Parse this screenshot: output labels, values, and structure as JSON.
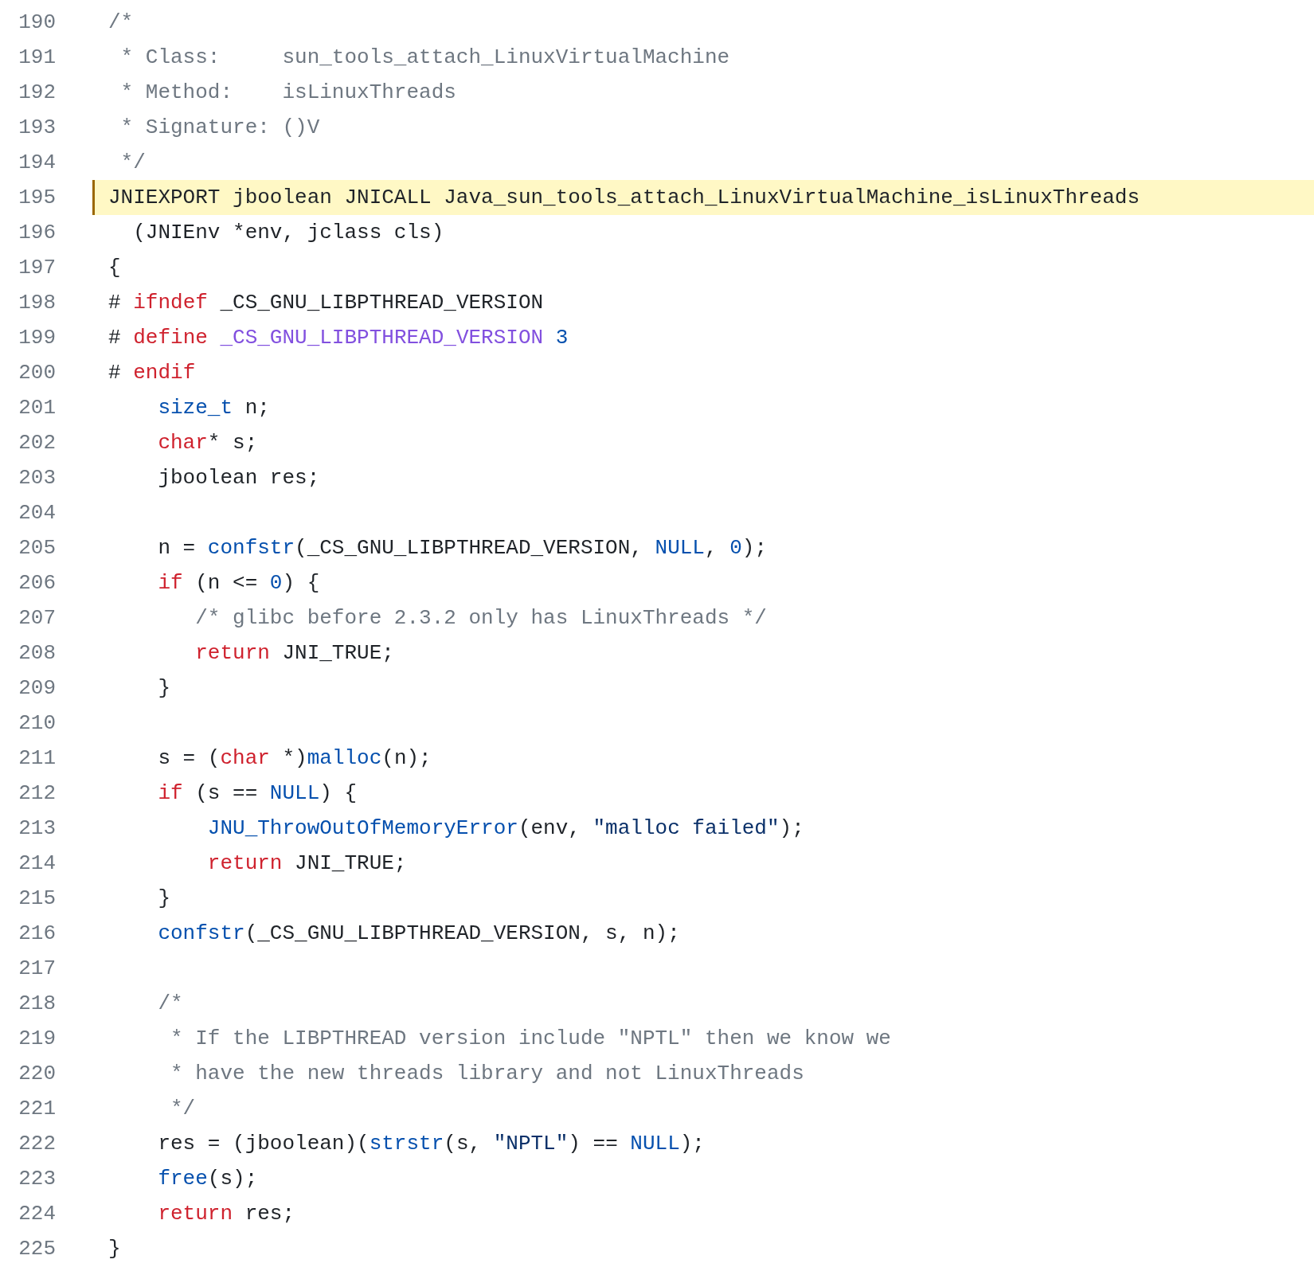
{
  "lines": [
    {
      "number": "190",
      "highlighted": false,
      "tokens": [
        {
          "text": "/*",
          "kind": "comment"
        }
      ]
    },
    {
      "number": "191",
      "highlighted": false,
      "tokens": [
        {
          "text": " * Class:     sun_tools_attach_LinuxVirtualMachine",
          "kind": "comment"
        }
      ]
    },
    {
      "number": "192",
      "highlighted": false,
      "tokens": [
        {
          "text": " * Method:    isLinuxThreads",
          "kind": "comment"
        }
      ]
    },
    {
      "number": "193",
      "highlighted": false,
      "tokens": [
        {
          "text": " * Signature: ()V",
          "kind": "comment"
        }
      ]
    },
    {
      "number": "194",
      "highlighted": false,
      "tokens": [
        {
          "text": " */",
          "kind": "comment"
        }
      ]
    },
    {
      "number": "195",
      "highlighted": true,
      "tokens": [
        {
          "text": "JNIEXPORT jboolean JNICALL Java_sun_tools_attach_LinuxVirtualMachine_isLinuxThreads",
          "kind": "plain"
        }
      ]
    },
    {
      "number": "196",
      "highlighted": false,
      "tokens": [
        {
          "text": "  (JNIEnv *env, jclass cls)",
          "kind": "plain"
        }
      ]
    },
    {
      "number": "197",
      "highlighted": false,
      "tokens": [
        {
          "text": "{",
          "kind": "plain"
        }
      ]
    },
    {
      "number": "198",
      "highlighted": false,
      "tokens": [
        {
          "text": "# ",
          "kind": "plain"
        },
        {
          "text": "ifndef",
          "kind": "keyword"
        },
        {
          "text": " _CS_GNU_LIBPTHREAD_VERSION",
          "kind": "plain"
        }
      ]
    },
    {
      "number": "199",
      "highlighted": false,
      "tokens": [
        {
          "text": "# ",
          "kind": "plain"
        },
        {
          "text": "define",
          "kind": "keyword"
        },
        {
          "text": " _CS_GNU_LIBPTHREAD_VERSION",
          "kind": "macro"
        },
        {
          "text": " 3",
          "kind": "constant"
        }
      ]
    },
    {
      "number": "200",
      "highlighted": false,
      "tokens": [
        {
          "text": "# ",
          "kind": "plain"
        },
        {
          "text": "endif",
          "kind": "keyword"
        }
      ]
    },
    {
      "number": "201",
      "highlighted": false,
      "tokens": [
        {
          "text": "    size_t",
          "kind": "constant"
        },
        {
          "text": " n;",
          "kind": "plain"
        }
      ]
    },
    {
      "number": "202",
      "highlighted": false,
      "tokens": [
        {
          "text": "    char",
          "kind": "keyword"
        },
        {
          "text": "* s;",
          "kind": "plain"
        }
      ]
    },
    {
      "number": "203",
      "highlighted": false,
      "tokens": [
        {
          "text": "    jboolean res;",
          "kind": "plain"
        }
      ]
    },
    {
      "number": "204",
      "highlighted": false
    },
    {
      "number": "205",
      "highlighted": false,
      "tokens": [
        {
          "text": "    n = ",
          "kind": "plain"
        },
        {
          "text": "confstr",
          "kind": "constant"
        },
        {
          "text": "(_CS_GNU_LIBPTHREAD_VERSION, ",
          "kind": "plain"
        },
        {
          "text": "NULL",
          "kind": "constant"
        },
        {
          "text": ", ",
          "kind": "plain"
        },
        {
          "text": "0",
          "kind": "constant"
        },
        {
          "text": ");",
          "kind": "plain"
        }
      ]
    },
    {
      "number": "206",
      "highlighted": false,
      "tokens": [
        {
          "text": "    if",
          "kind": "keyword"
        },
        {
          "text": " (n <= ",
          "kind": "plain"
        },
        {
          "text": "0",
          "kind": "constant"
        },
        {
          "text": ") {",
          "kind": "plain"
        }
      ]
    },
    {
      "number": "207",
      "highlighted": false,
      "tokens": [
        {
          "text": "       /* glibc before 2.3.2 only has LinuxThreads */",
          "kind": "comment"
        }
      ]
    },
    {
      "number": "208",
      "highlighted": false,
      "tokens": [
        {
          "text": "       return",
          "kind": "keyword"
        },
        {
          "text": " JNI_TRUE;",
          "kind": "plain"
        }
      ]
    },
    {
      "number": "209",
      "highlighted": false,
      "tokens": [
        {
          "text": "    }",
          "kind": "plain"
        }
      ]
    },
    {
      "number": "210",
      "highlighted": false
    },
    {
      "number": "211",
      "highlighted": false,
      "tokens": [
        {
          "text": "    s = (",
          "kind": "plain"
        },
        {
          "text": "char",
          "kind": "keyword"
        },
        {
          "text": " *)",
          "kind": "plain"
        },
        {
          "text": "malloc",
          "kind": "constant"
        },
        {
          "text": "(n);",
          "kind": "plain"
        }
      ]
    },
    {
      "number": "212",
      "highlighted": false,
      "tokens": [
        {
          "text": "    if",
          "kind": "keyword"
        },
        {
          "text": " (s == ",
          "kind": "plain"
        },
        {
          "text": "NULL",
          "kind": "constant"
        },
        {
          "text": ") {",
          "kind": "plain"
        }
      ]
    },
    {
      "number": "213",
      "highlighted": false,
      "tokens": [
        {
          "text": "        JNU_ThrowOutOfMemoryError",
          "kind": "constant"
        },
        {
          "text": "(env, ",
          "kind": "plain"
        },
        {
          "text": "\"malloc failed\"",
          "kind": "string"
        },
        {
          "text": ");",
          "kind": "plain"
        }
      ]
    },
    {
      "number": "214",
      "highlighted": false,
      "tokens": [
        {
          "text": "        return",
          "kind": "keyword"
        },
        {
          "text": " JNI_TRUE;",
          "kind": "plain"
        }
      ]
    },
    {
      "number": "215",
      "highlighted": false,
      "tokens": [
        {
          "text": "    }",
          "kind": "plain"
        }
      ]
    },
    {
      "number": "216",
      "highlighted": false,
      "tokens": [
        {
          "text": "    confstr",
          "kind": "constant"
        },
        {
          "text": "(_CS_GNU_LIBPTHREAD_VERSION, s, n);",
          "kind": "plain"
        }
      ]
    },
    {
      "number": "217",
      "highlighted": false
    },
    {
      "number": "218",
      "highlighted": false,
      "tokens": [
        {
          "text": "    /*",
          "kind": "comment"
        }
      ]
    },
    {
      "number": "219",
      "highlighted": false,
      "tokens": [
        {
          "text": "     * If the LIBPTHREAD version include \"NPTL\" then we know we",
          "kind": "comment"
        }
      ]
    },
    {
      "number": "220",
      "highlighted": false,
      "tokens": [
        {
          "text": "     * have the new threads library and not LinuxThreads",
          "kind": "comment"
        }
      ]
    },
    {
      "number": "221",
      "highlighted": false,
      "tokens": [
        {
          "text": "     */",
          "kind": "comment"
        }
      ]
    },
    {
      "number": "222",
      "highlighted": false,
      "tokens": [
        {
          "text": "    res = (jboolean)(",
          "kind": "plain"
        },
        {
          "text": "strstr",
          "kind": "constant"
        },
        {
          "text": "(s, ",
          "kind": "plain"
        },
        {
          "text": "\"NPTL\"",
          "kind": "string"
        },
        {
          "text": ") == ",
          "kind": "plain"
        },
        {
          "text": "NULL",
          "kind": "constant"
        },
        {
          "text": ");",
          "kind": "plain"
        }
      ]
    },
    {
      "number": "223",
      "highlighted": false,
      "tokens": [
        {
          "text": "    free",
          "kind": "constant"
        },
        {
          "text": "(s);",
          "kind": "plain"
        }
      ]
    },
    {
      "number": "224",
      "highlighted": false,
      "tokens": [
        {
          "text": "    return",
          "kind": "keyword"
        },
        {
          "text": " res;",
          "kind": "plain"
        }
      ]
    },
    {
      "number": "225",
      "highlighted": false,
      "tokens": [
        {
          "text": "}",
          "kind": "plain"
        }
      ]
    }
  ]
}
